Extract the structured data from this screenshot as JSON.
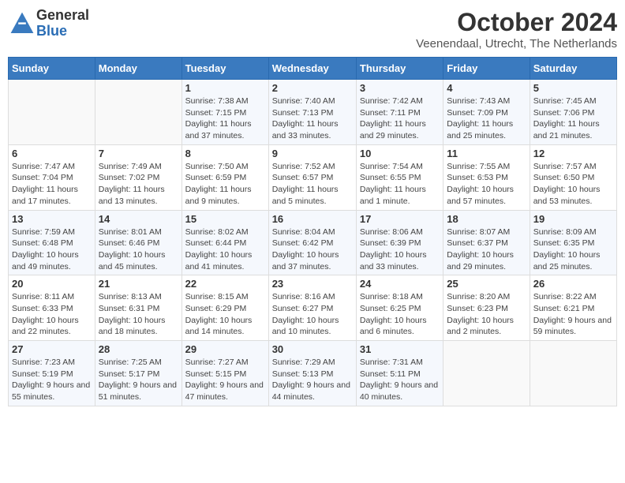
{
  "header": {
    "logo_general": "General",
    "logo_blue": "Blue",
    "month_year": "October 2024",
    "location": "Veenendaal, Utrecht, The Netherlands"
  },
  "days_of_week": [
    "Sunday",
    "Monday",
    "Tuesday",
    "Wednesday",
    "Thursday",
    "Friday",
    "Saturday"
  ],
  "weeks": [
    [
      {
        "day": "",
        "sunrise": "",
        "sunset": "",
        "daylight": ""
      },
      {
        "day": "",
        "sunrise": "",
        "sunset": "",
        "daylight": ""
      },
      {
        "day": "1",
        "sunrise": "Sunrise: 7:38 AM",
        "sunset": "Sunset: 7:15 PM",
        "daylight": "Daylight: 11 hours and 37 minutes."
      },
      {
        "day": "2",
        "sunrise": "Sunrise: 7:40 AM",
        "sunset": "Sunset: 7:13 PM",
        "daylight": "Daylight: 11 hours and 33 minutes."
      },
      {
        "day": "3",
        "sunrise": "Sunrise: 7:42 AM",
        "sunset": "Sunset: 7:11 PM",
        "daylight": "Daylight: 11 hours and 29 minutes."
      },
      {
        "day": "4",
        "sunrise": "Sunrise: 7:43 AM",
        "sunset": "Sunset: 7:09 PM",
        "daylight": "Daylight: 11 hours and 25 minutes."
      },
      {
        "day": "5",
        "sunrise": "Sunrise: 7:45 AM",
        "sunset": "Sunset: 7:06 PM",
        "daylight": "Daylight: 11 hours and 21 minutes."
      }
    ],
    [
      {
        "day": "6",
        "sunrise": "Sunrise: 7:47 AM",
        "sunset": "Sunset: 7:04 PM",
        "daylight": "Daylight: 11 hours and 17 minutes."
      },
      {
        "day": "7",
        "sunrise": "Sunrise: 7:49 AM",
        "sunset": "Sunset: 7:02 PM",
        "daylight": "Daylight: 11 hours and 13 minutes."
      },
      {
        "day": "8",
        "sunrise": "Sunrise: 7:50 AM",
        "sunset": "Sunset: 6:59 PM",
        "daylight": "Daylight: 11 hours and 9 minutes."
      },
      {
        "day": "9",
        "sunrise": "Sunrise: 7:52 AM",
        "sunset": "Sunset: 6:57 PM",
        "daylight": "Daylight: 11 hours and 5 minutes."
      },
      {
        "day": "10",
        "sunrise": "Sunrise: 7:54 AM",
        "sunset": "Sunset: 6:55 PM",
        "daylight": "Daylight: 11 hours and 1 minute."
      },
      {
        "day": "11",
        "sunrise": "Sunrise: 7:55 AM",
        "sunset": "Sunset: 6:53 PM",
        "daylight": "Daylight: 10 hours and 57 minutes."
      },
      {
        "day": "12",
        "sunrise": "Sunrise: 7:57 AM",
        "sunset": "Sunset: 6:50 PM",
        "daylight": "Daylight: 10 hours and 53 minutes."
      }
    ],
    [
      {
        "day": "13",
        "sunrise": "Sunrise: 7:59 AM",
        "sunset": "Sunset: 6:48 PM",
        "daylight": "Daylight: 10 hours and 49 minutes."
      },
      {
        "day": "14",
        "sunrise": "Sunrise: 8:01 AM",
        "sunset": "Sunset: 6:46 PM",
        "daylight": "Daylight: 10 hours and 45 minutes."
      },
      {
        "day": "15",
        "sunrise": "Sunrise: 8:02 AM",
        "sunset": "Sunset: 6:44 PM",
        "daylight": "Daylight: 10 hours and 41 minutes."
      },
      {
        "day": "16",
        "sunrise": "Sunrise: 8:04 AM",
        "sunset": "Sunset: 6:42 PM",
        "daylight": "Daylight: 10 hours and 37 minutes."
      },
      {
        "day": "17",
        "sunrise": "Sunrise: 8:06 AM",
        "sunset": "Sunset: 6:39 PM",
        "daylight": "Daylight: 10 hours and 33 minutes."
      },
      {
        "day": "18",
        "sunrise": "Sunrise: 8:07 AM",
        "sunset": "Sunset: 6:37 PM",
        "daylight": "Daylight: 10 hours and 29 minutes."
      },
      {
        "day": "19",
        "sunrise": "Sunrise: 8:09 AM",
        "sunset": "Sunset: 6:35 PM",
        "daylight": "Daylight: 10 hours and 25 minutes."
      }
    ],
    [
      {
        "day": "20",
        "sunrise": "Sunrise: 8:11 AM",
        "sunset": "Sunset: 6:33 PM",
        "daylight": "Daylight: 10 hours and 22 minutes."
      },
      {
        "day": "21",
        "sunrise": "Sunrise: 8:13 AM",
        "sunset": "Sunset: 6:31 PM",
        "daylight": "Daylight: 10 hours and 18 minutes."
      },
      {
        "day": "22",
        "sunrise": "Sunrise: 8:15 AM",
        "sunset": "Sunset: 6:29 PM",
        "daylight": "Daylight: 10 hours and 14 minutes."
      },
      {
        "day": "23",
        "sunrise": "Sunrise: 8:16 AM",
        "sunset": "Sunset: 6:27 PM",
        "daylight": "Daylight: 10 hours and 10 minutes."
      },
      {
        "day": "24",
        "sunrise": "Sunrise: 8:18 AM",
        "sunset": "Sunset: 6:25 PM",
        "daylight": "Daylight: 10 hours and 6 minutes."
      },
      {
        "day": "25",
        "sunrise": "Sunrise: 8:20 AM",
        "sunset": "Sunset: 6:23 PM",
        "daylight": "Daylight: 10 hours and 2 minutes."
      },
      {
        "day": "26",
        "sunrise": "Sunrise: 8:22 AM",
        "sunset": "Sunset: 6:21 PM",
        "daylight": "Daylight: 9 hours and 59 minutes."
      }
    ],
    [
      {
        "day": "27",
        "sunrise": "Sunrise: 7:23 AM",
        "sunset": "Sunset: 5:19 PM",
        "daylight": "Daylight: 9 hours and 55 minutes."
      },
      {
        "day": "28",
        "sunrise": "Sunrise: 7:25 AM",
        "sunset": "Sunset: 5:17 PM",
        "daylight": "Daylight: 9 hours and 51 minutes."
      },
      {
        "day": "29",
        "sunrise": "Sunrise: 7:27 AM",
        "sunset": "Sunset: 5:15 PM",
        "daylight": "Daylight: 9 hours and 47 minutes."
      },
      {
        "day": "30",
        "sunrise": "Sunrise: 7:29 AM",
        "sunset": "Sunset: 5:13 PM",
        "daylight": "Daylight: 9 hours and 44 minutes."
      },
      {
        "day": "31",
        "sunrise": "Sunrise: 7:31 AM",
        "sunset": "Sunset: 5:11 PM",
        "daylight": "Daylight: 9 hours and 40 minutes."
      },
      {
        "day": "",
        "sunrise": "",
        "sunset": "",
        "daylight": ""
      },
      {
        "day": "",
        "sunrise": "",
        "sunset": "",
        "daylight": ""
      }
    ]
  ]
}
